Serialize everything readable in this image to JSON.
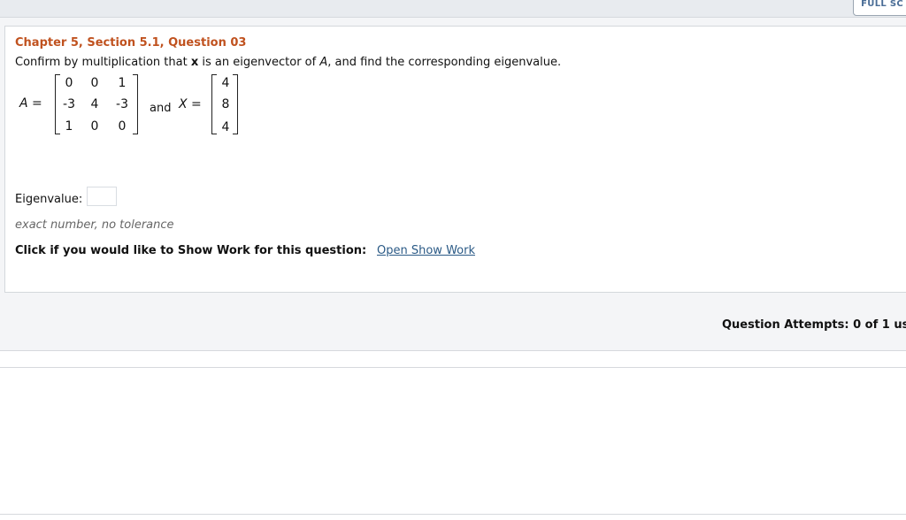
{
  "header": {
    "full_screen_label": "FULL SC"
  },
  "question": {
    "title": "Chapter 5, Section 5.1, Question 03",
    "prompt": {
      "p1": "Confirm by multiplication that ",
      "x_bold": "x",
      "p2": " is an eigenvector of ",
      "a_italic": "A",
      "p3": ", and find the corresponding eigenvalue."
    },
    "math": {
      "a_label": "A",
      "equals": "=",
      "matrix_a": [
        [
          "0",
          "0",
          "1"
        ],
        [
          "-3",
          "4",
          "-3"
        ],
        [
          "1",
          "0",
          "0"
        ]
      ],
      "and_text": "and",
      "x_label": "X",
      "vector_x": [
        "4",
        "8",
        "4"
      ]
    },
    "eigenvalue_label": "Eigenvalue:",
    "eigenvalue_value": "",
    "hint": "exact number, no tolerance",
    "show_work_label": "Click if you would like to Show Work for this question:",
    "show_work_link": "Open Show Work"
  },
  "footer": {
    "attempts": "Question Attempts: 0 of 1 us"
  }
}
